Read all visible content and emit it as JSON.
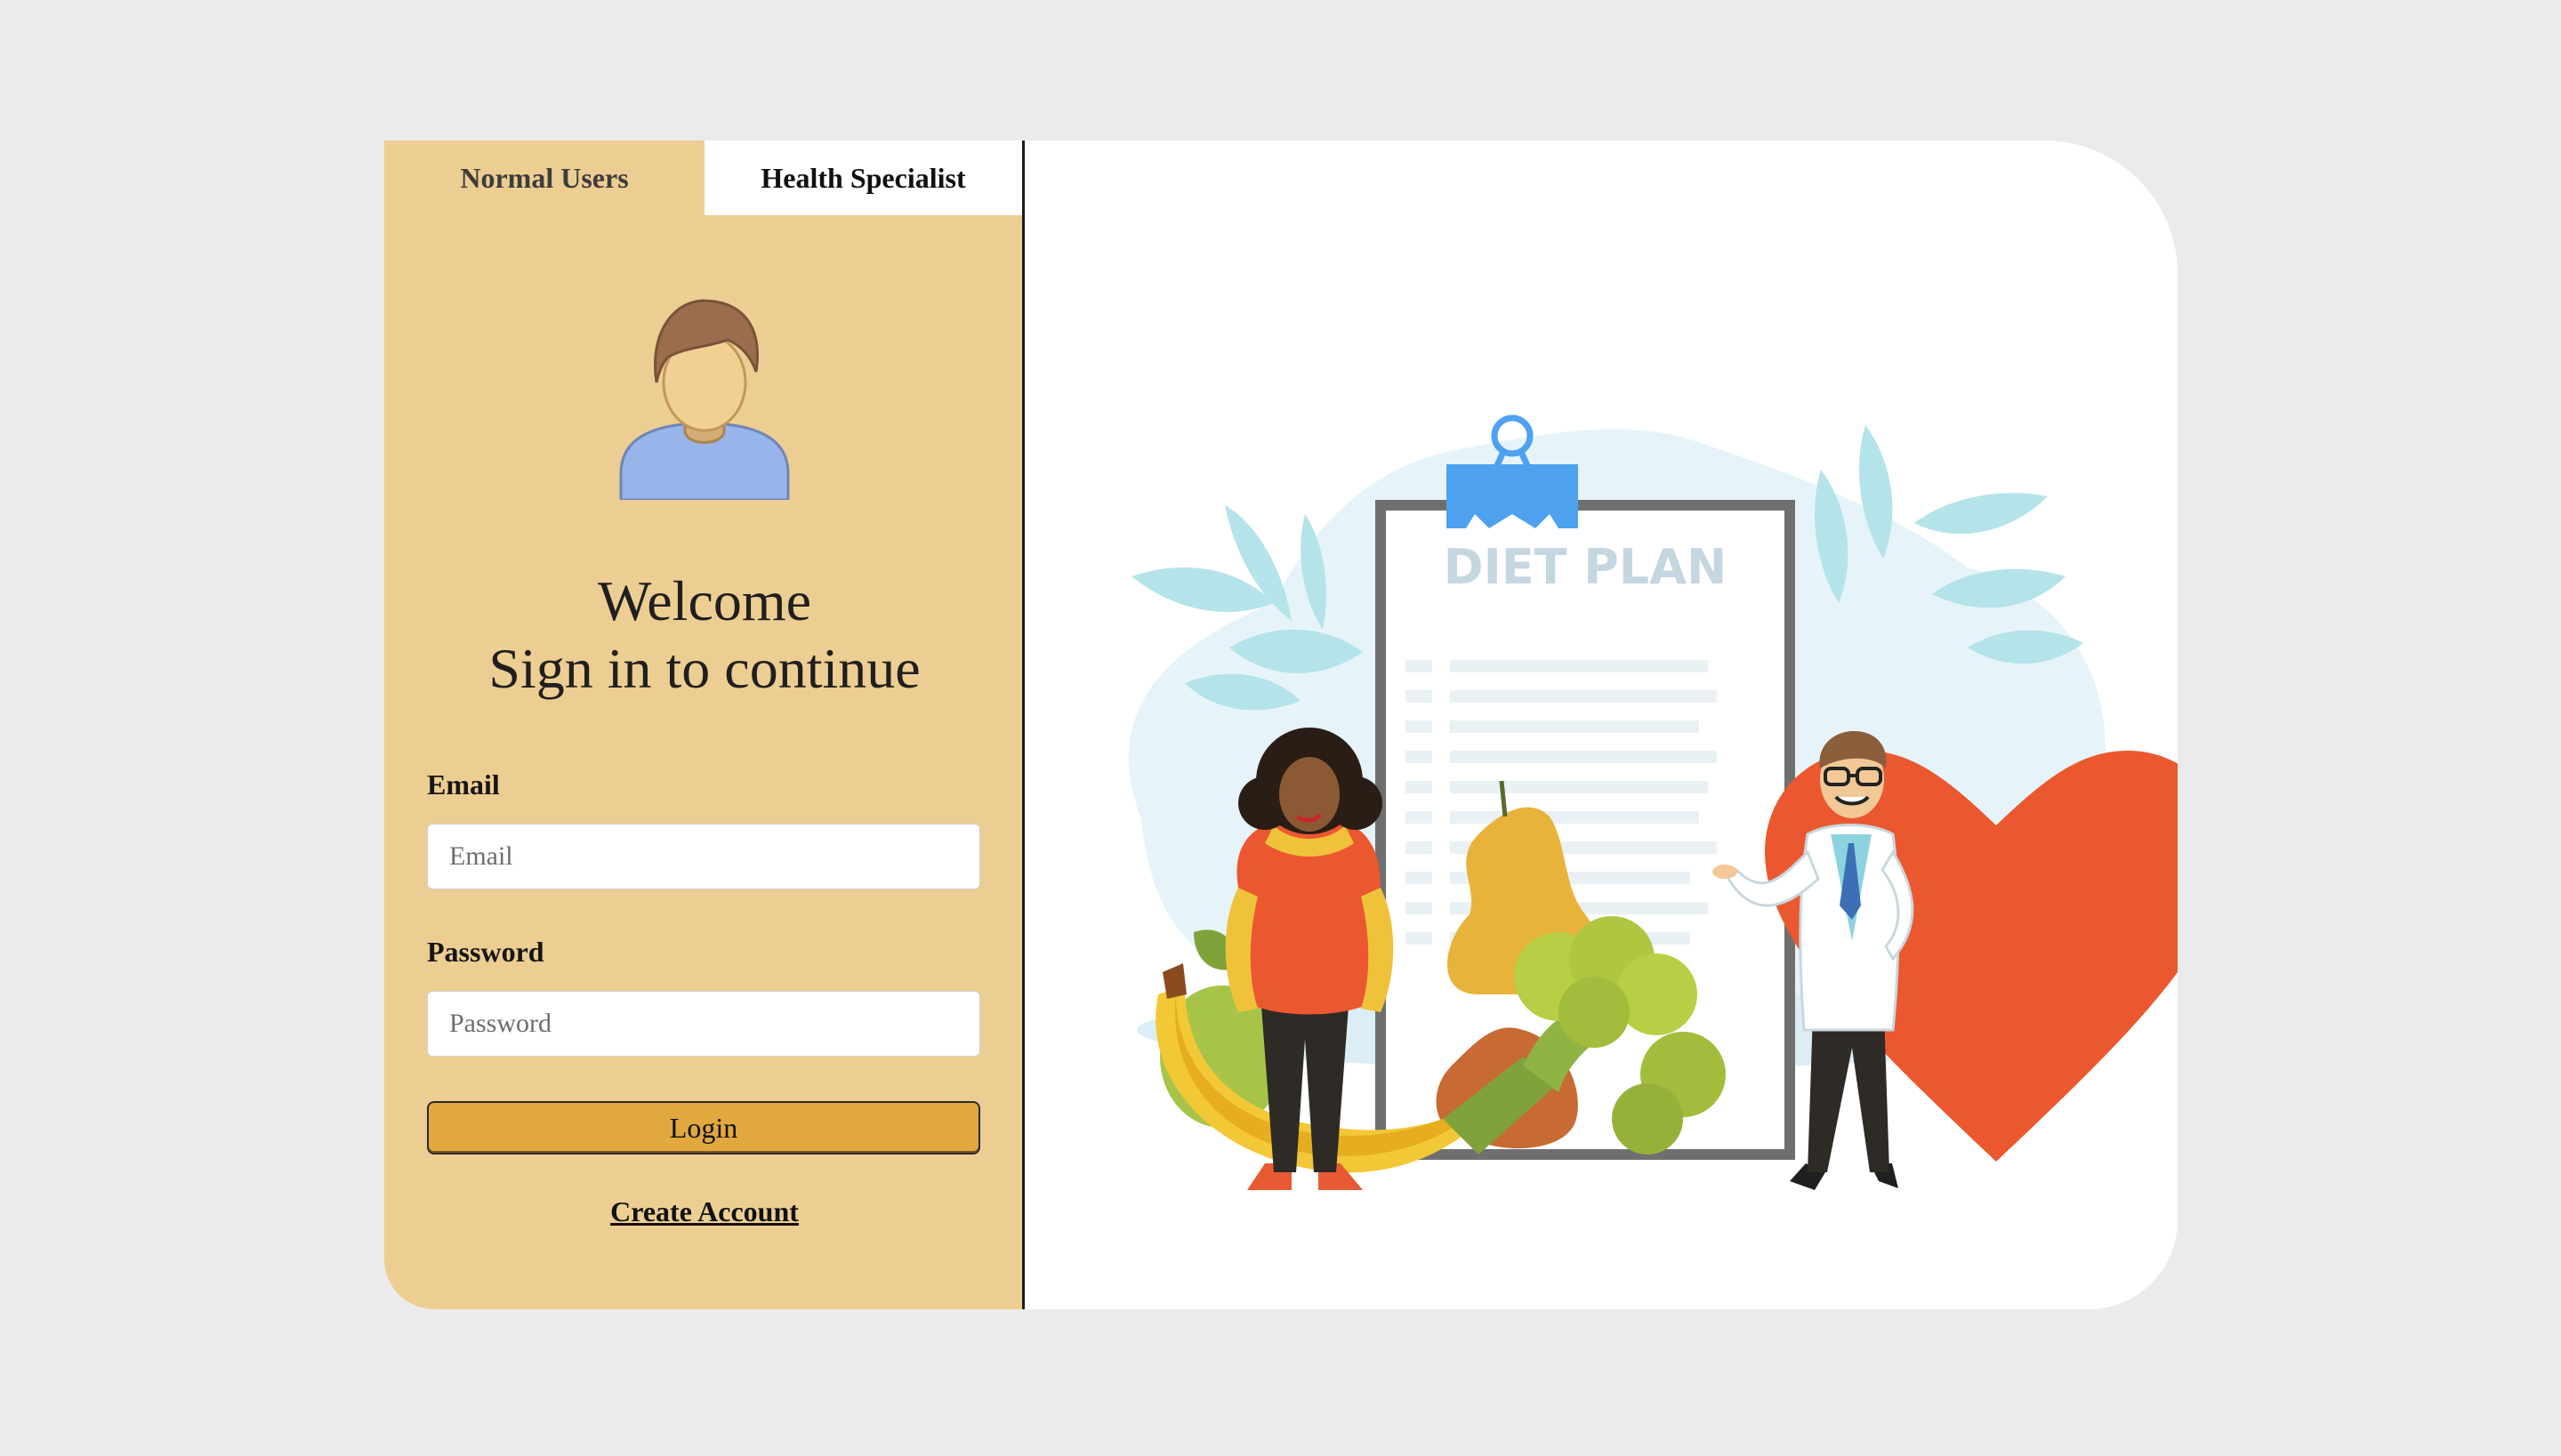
{
  "tabs": {
    "normal_users": "Normal Users",
    "health_specialist": "Health Specialist"
  },
  "welcome": {
    "line1": "Welcome",
    "line2": "Sign in to continue"
  },
  "form": {
    "email_label": "Email",
    "email_placeholder": "Email",
    "email_value": "",
    "password_label": "Password",
    "password_placeholder": "Password",
    "password_value": "",
    "login_label": "Login",
    "create_account_label": "Create Account"
  },
  "illustration": {
    "clipboard_title": "DIET PLAN"
  },
  "colors": {
    "panel": "#edce92",
    "accent_button": "#e1a840",
    "heart": "#eb5830",
    "clip": "#4ea1ef"
  },
  "icons": {
    "avatar": "user-avatar-icon"
  }
}
